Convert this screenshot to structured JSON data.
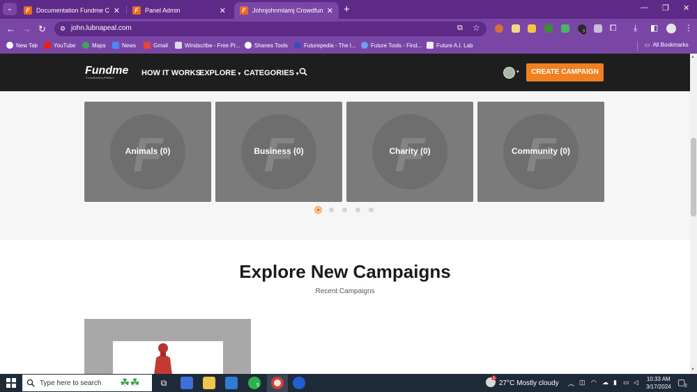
{
  "browser": {
    "tabs": [
      {
        "label": "Documentation Fundme Crowdf",
        "active": false
      },
      {
        "label": "Panel Admin",
        "active": false
      },
      {
        "label": "Johnjohnmlamj Crowdfunding |",
        "active": true
      }
    ],
    "favicon_letter": "F",
    "url": "john.lubnapeal.com",
    "bookmarks": [
      "New Tab",
      "YouTube",
      "Maps",
      "News",
      "Gmail",
      "Windscribe - Free Pr...",
      "Shanes Tools",
      "Futurepedia - The I...",
      "Future Tools - Find...",
      "Future A.I. Lab"
    ],
    "all_bookmarks": "All Bookmarks",
    "extension_badge": "0"
  },
  "site": {
    "logo": "Fundme",
    "logo_sub": "Crowdfunding Platform",
    "nav": {
      "how_it_works": "HOW IT WORKS",
      "explore": "EXPLORE",
      "categories": "CATEGORIES"
    },
    "create_campaign": "CREATE CAMPAIGN"
  },
  "categories": {
    "card_letter": "F",
    "items": [
      {
        "label": "Animals (0)"
      },
      {
        "label": "Business (0)"
      },
      {
        "label": "Charity (0)"
      },
      {
        "label": "Community (0)"
      }
    ],
    "carousel_pages": 5,
    "carousel_active": 1
  },
  "explore": {
    "title": "Explore New Campaigns",
    "subtitle": "Recent Campaigns"
  },
  "taskbar": {
    "search_placeholder": "Type here to search",
    "whatsapp_badge": "5",
    "weather_badge": "1",
    "weather": "27°C  Mostly cloudy",
    "time": "10:33 AM",
    "date": "3/17/2024",
    "notification_count": "2"
  },
  "colors": {
    "browser_purple": "#5e2a87",
    "toolbar_purple": "#7a46a6",
    "accent_orange": "#f08020",
    "site_header": "#1e1e1e",
    "card_grey": "#7b7b7b"
  }
}
